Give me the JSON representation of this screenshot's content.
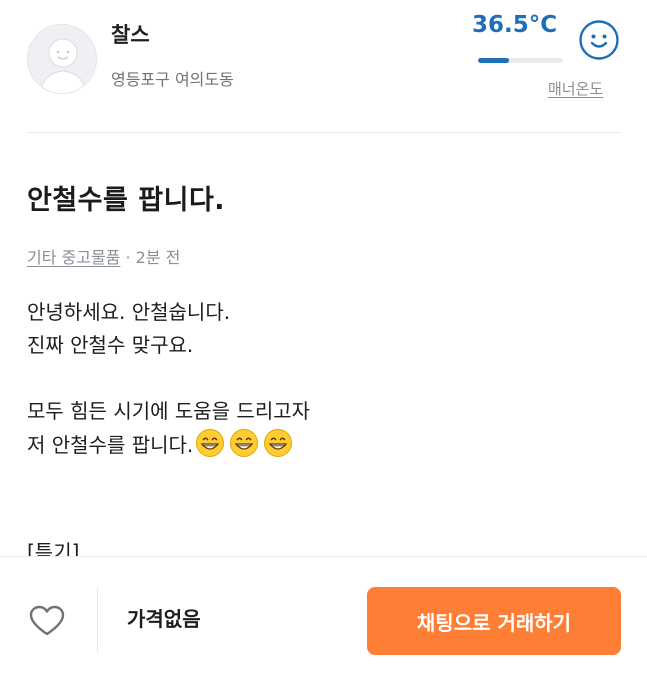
{
  "seller": {
    "name": "찰스",
    "location": "영등포구 여의도동",
    "avatar_icon": "default-avatar-icon"
  },
  "manner": {
    "temperature": "36.5°C",
    "temperature_value": 36.5,
    "bar_fill_percent": 36.5,
    "label": "매너온도",
    "face_icon": "smile-face-icon",
    "color": "#1f6fb8"
  },
  "post": {
    "title": "안철수를 팝니다.",
    "category": "기타 중고물품",
    "time": " · 2분 전",
    "body": {
      "line1": "안녕하세요. 안철숩니다.",
      "line2": "진짜 안철수 맞구요.",
      "line3": "모두 힘든 시기에 도움을 드리고자",
      "line4": "저 안철수를 팝니다.",
      "line5": "[특기]"
    },
    "emojis": [
      "grinning-face-icon",
      "grinning-face-icon",
      "grinning-face-icon"
    ]
  },
  "bottom_bar": {
    "like_icon": "heart-icon",
    "price": "가격없음",
    "chat_button": "채팅으로 거래하기",
    "accent_color": "#ff7e36"
  }
}
